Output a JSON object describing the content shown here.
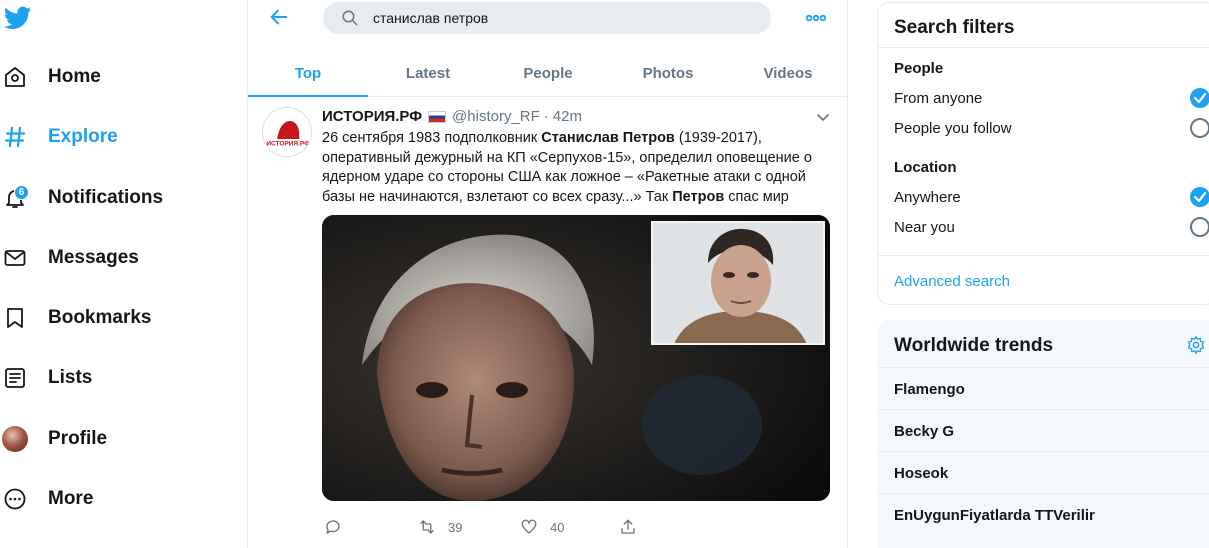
{
  "nav": {
    "items": [
      {
        "label": "Home",
        "icon": "home-icon"
      },
      {
        "label": "Explore",
        "icon": "hashtag-icon",
        "active": true
      },
      {
        "label": "Notifications",
        "icon": "bell-icon",
        "badge": "6"
      },
      {
        "label": "Messages",
        "icon": "envelope-icon"
      },
      {
        "label": "Bookmarks",
        "icon": "bookmark-icon"
      },
      {
        "label": "Lists",
        "icon": "list-icon"
      },
      {
        "label": "Profile",
        "icon": "avatar"
      },
      {
        "label": "More",
        "icon": "more-circle-icon"
      }
    ]
  },
  "search": {
    "value": "станислав петров"
  },
  "tabs": [
    {
      "label": "Top",
      "active": true
    },
    {
      "label": "Latest"
    },
    {
      "label": "People"
    },
    {
      "label": "Photos"
    },
    {
      "label": "Videos"
    }
  ],
  "tweet": {
    "name": "ИСТОРИЯ.РФ",
    "handle": "@history_RF",
    "sep": "·",
    "time": "42m",
    "text": {
      "p1": "26 сентября 1983 подполковник ",
      "b1": "Станислав Петров",
      "p2": " (1939-2017), оперативный дежурный на КП «Серпухов-15», определил оповещение о ядерном ударе со стороны США как ложное – «Ракетные атаки с одной базы не начинаются, взлетают со всех сразу...» Так ",
      "b2": "Петров",
      "p3": " спас мир"
    },
    "retweets": "39",
    "likes": "40",
    "avatar_text": "ИСТОРИЯ.РФ"
  },
  "filters": {
    "title": "Search filters",
    "people_label": "People",
    "from_anyone": "From anyone",
    "people_you_follow": "People you follow",
    "location_label": "Location",
    "anywhere": "Anywhere",
    "near_you": "Near you",
    "advanced": "Advanced search"
  },
  "trends": {
    "title": "Worldwide trends",
    "items": [
      "Flamengo",
      "Becky G",
      "Hoseok",
      "EnUygunFiyatlarda TTVerilir"
    ]
  },
  "colors": {
    "accent": "#1da1f2",
    "text": "#14171a",
    "muted": "#657786",
    "border": "#e6ecf0"
  }
}
